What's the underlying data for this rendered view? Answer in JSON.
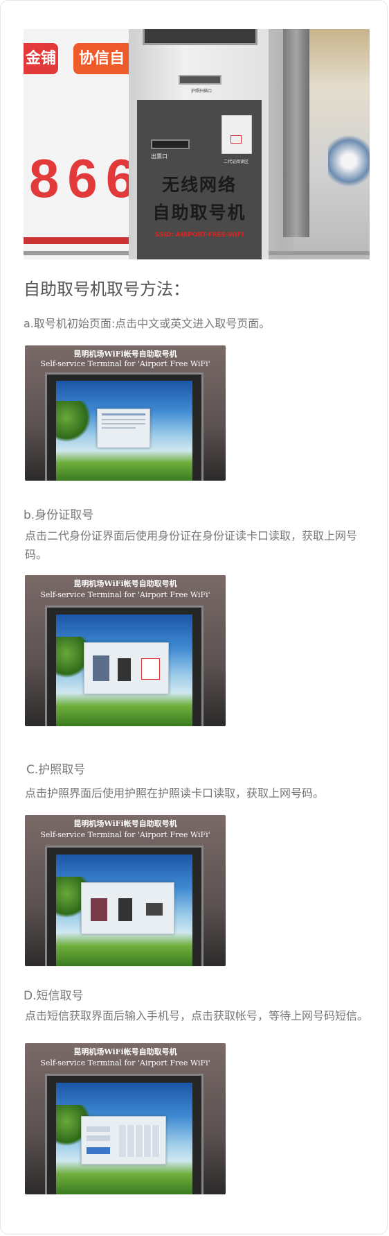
{
  "top_photo": {
    "kiosk_caption_line1": "无线网络",
    "kiosk_caption_line2": "自助取号机",
    "ssid": "SSID: AIRPORT-FREE-WIFI",
    "sign_left": "金铺",
    "sign_right": "协信自",
    "big_number": "866",
    "label_passport": "护照扫描口",
    "label_ticket": "出票口",
    "label_idcard": "二代证阅读区"
  },
  "heading": "自助取号机取号方法：",
  "steps": [
    {
      "label": "a.取号机初始页面:点击中文或英文进入取号页面。",
      "screen_title_cn": "昆明机场WiFi帐号自助取号机",
      "screen_title_en": "Self-service Terminal for 'Airport Free WiFi'"
    },
    {
      "label": "b.身份证取号",
      "desc": "点击二代身份证界面后使用身份证在身份证读卡口读取，获取上网号码。",
      "screen_title_cn": "昆明机场WiFi帐号自助取号机",
      "screen_title_en": "Self-service Terminal for 'Airport Free WiFi'"
    },
    {
      "label": "C.护照取号",
      "desc": "点击护照界面后使用护照在护照读卡口读取，获取上网号码。",
      "screen_title_cn": "昆明机场WiFi帐号自助取号机",
      "screen_title_en": "Self-service Terminal for 'Airport Free WiFi'"
    },
    {
      "label": "D.短信取号",
      "desc": "点击短信获取界面后输入手机号，点击获取帐号，等待上网号码短信。",
      "screen_title_cn": "昆明机场WiFi帐号自助取号机",
      "screen_title_en": "Self-service Terminal for 'Airport Free WiFi'"
    }
  ]
}
